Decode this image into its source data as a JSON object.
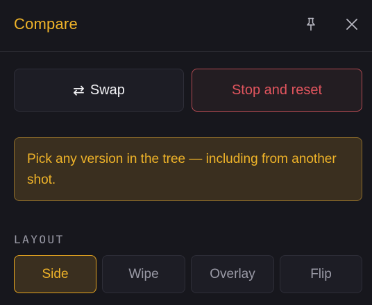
{
  "header": {
    "title": "Compare",
    "pin_icon": "pin-icon",
    "close_icon": "close-icon"
  },
  "actions": {
    "swap_symbol": "⇄",
    "swap_label": "Swap",
    "stop_label": "Stop and reset"
  },
  "note": {
    "text": "Pick any version in the tree — including from another shot."
  },
  "layout": {
    "label": "LAYOUT",
    "options": [
      "Side",
      "Wipe",
      "Overlay",
      "Flip"
    ],
    "selected": "Side"
  },
  "colors": {
    "accent": "#f0b429",
    "danger": "#e2555e",
    "background": "#17171d"
  }
}
